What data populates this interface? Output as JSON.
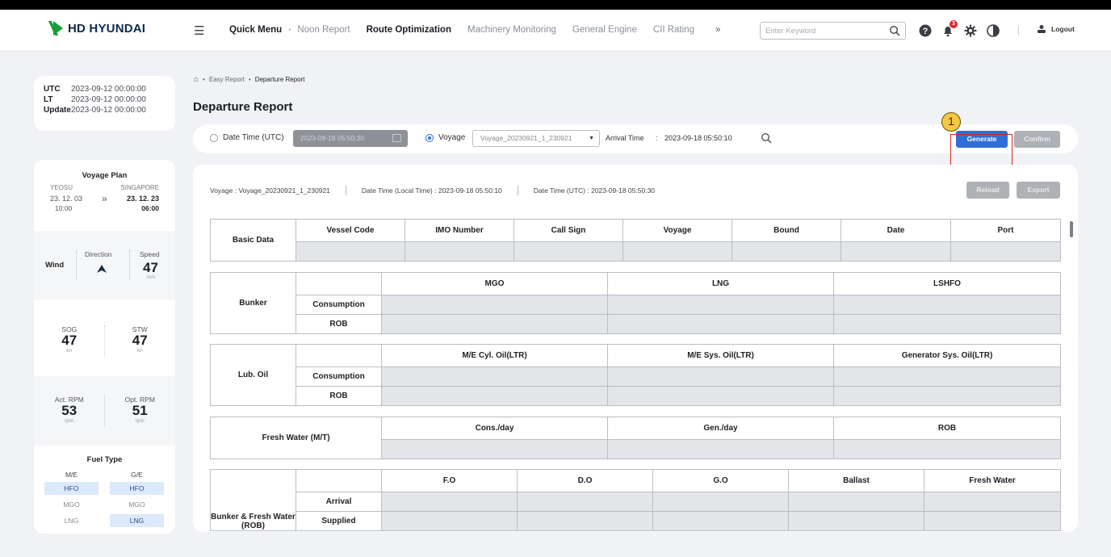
{
  "brand": {
    "name": "HD HYUNDAI"
  },
  "nav": {
    "quick_menu": "Quick Menu",
    "sep": "•",
    "items": [
      "Noon Report",
      "Route Optimization",
      "Machinery Monitoring",
      "General Engine",
      "CII Rating"
    ],
    "active": "Route Optimization",
    "more": "»",
    "search_placeholder": "Enter Keyword",
    "notif_count": "3",
    "logout": "Logout"
  },
  "times": {
    "utc_label": "UTC",
    "utc": "2023-09-12 00:00:00",
    "lt_label": "LT",
    "lt": "2023-09-12 00:00:00",
    "update_label": "Update",
    "update": "2023-09-12 00:00:00"
  },
  "voyage_plan": {
    "title": "Voyage Plan",
    "from_port": "YEOSU",
    "to_port": "SINGAPORE",
    "from_date": "23. 12. 03",
    "to_date": "23. 12. 23",
    "from_time": "10:00",
    "to_time": "06:00"
  },
  "wind": {
    "label": "Wind",
    "direction_label": "Direction",
    "speed_label": "Speed",
    "speed": "47",
    "speed_unit": "m/s"
  },
  "speed": {
    "sog_label": "SOG",
    "sog": "47",
    "sog_unit": "kn",
    "stw_label": "STW",
    "stw": "47",
    "stw_unit": "kn"
  },
  "rpm": {
    "act_label": "Act. RPM",
    "act": "53",
    "act_unit": "rpm",
    "opt_label": "Opt. RPM",
    "opt": "51",
    "opt_unit": "rpm"
  },
  "fuel": {
    "title": "Fuel Type",
    "me_label": "M/E",
    "ge_label": "G/E",
    "me": [
      "HFO",
      "MGO",
      "LNG"
    ],
    "ge": [
      "HFO",
      "MGO",
      "LNG"
    ],
    "me_selected": "HFO",
    "ge_selected": [
      "HFO",
      "LNG"
    ]
  },
  "breadcrumb": {
    "home": "⌂",
    "sep": "•",
    "parent": "Easy Report",
    "current": "Departure Report"
  },
  "page_title": "Departure Report",
  "filter": {
    "date_time_label": "Date Time (UTC)",
    "date_time_value": "2023-09-18 05:50:30",
    "voyage_label": "Voyage",
    "voyage_value": "Voyage_20230921_1_230921",
    "arrival_label": "Arrival Time",
    "arrival_colon": ":",
    "arrival_value": "2023-09-18 05:50:10",
    "generate": "Generate",
    "confirm": "Confirm",
    "callout": "1"
  },
  "info": {
    "voyage": "Voyage : Voyage_20230921_1_230921",
    "local_time": "Date Time (Local Time) : 2023-09-18 05:50:10",
    "utc_time": "Date Time (UTC)  :  2023-09-18  05:50:30",
    "reload": "Reload",
    "export": "Export"
  },
  "basic": {
    "label": "Basic Data",
    "columns": [
      "Vessel Code",
      "IMO Number",
      "Call Sign",
      "Voyage",
      "Bound",
      "Date",
      "Port"
    ]
  },
  "bunker": {
    "label": "Bunker",
    "columns": [
      "MGO",
      "LNG",
      "LSHFO"
    ],
    "rows": [
      "Consumption",
      "ROB"
    ]
  },
  "lub": {
    "label": "Lub. Oil",
    "columns": [
      "M/E Cyl. Oil(LTR)",
      "M/E Sys. Oil(LTR)",
      "Generator Sys. Oil(LTR)"
    ],
    "rows": [
      "Consumption",
      "ROB"
    ]
  },
  "fresh": {
    "label": "Fresh Water (M/T)",
    "columns": [
      "Cons./day",
      "Gen./day",
      "ROB"
    ]
  },
  "bfw": {
    "label": "Bunker & Fresh Water (ROB)",
    "columns": [
      "F.O",
      "D.O",
      "G.O",
      "Ballast",
      "Fresh Water"
    ],
    "rows": [
      "Arrival",
      "Supplied"
    ]
  },
  "colors": {
    "primary": "#2f6ed6",
    "brand_green": "#1a9e3a",
    "highlight": "#d1261f",
    "callout": "#f5c842"
  }
}
